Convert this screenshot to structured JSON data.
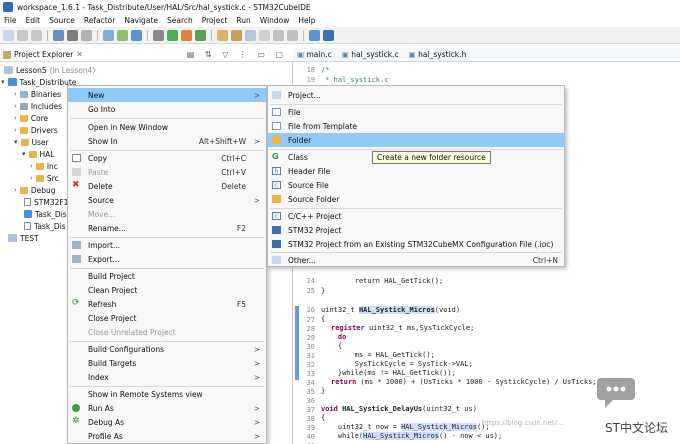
{
  "window": {
    "title": "workspace_1.6.1 - Task_Distribute/User/HAL/Src/hal_systick.c - STM32CubeIDE"
  },
  "menubar": [
    "File",
    "Edit",
    "Source",
    "Refactor",
    "Navigate",
    "Search",
    "Project",
    "Run",
    "Window",
    "Help"
  ],
  "explorer": {
    "title": "Project Explorer",
    "tree": [
      {
        "label": "Lesson5",
        "suffix": "(in Lesson4)"
      },
      {
        "label": "Task_Distribute"
      },
      {
        "label": "Binaries"
      },
      {
        "label": "Includes"
      },
      {
        "label": "Core"
      },
      {
        "label": "Drivers"
      },
      {
        "label": "User"
      },
      {
        "label": "HAL"
      },
      {
        "label": "Inc"
      },
      {
        "label": "Src"
      },
      {
        "label": "Debug"
      },
      {
        "label": "STM32F1"
      },
      {
        "label": "Task_Dis"
      },
      {
        "label": "Task_Dis"
      },
      {
        "label": "TEST"
      }
    ]
  },
  "editor": {
    "tabs": [
      "main.c",
      "hal_systick.c",
      "hal_systick.h"
    ],
    "line_numbers": [
      "18",
      "19",
      "20",
      "24",
      "25",
      "26",
      "27",
      "28",
      "29",
      "30",
      "31",
      "32",
      "33",
      "34",
      "35",
      "36",
      "37",
      "38",
      "39",
      "40",
      "41"
    ],
    "code": {
      "l18": "/*",
      "l19": " * hal_systick.c",
      "l20": " *",
      "l24": "    return HAL_GetTick();",
      "l25": "}",
      "l26_type": "uint32_t ",
      "l26_fn": "HAL_Systick_Micros",
      "l26_rest": "(void)",
      "l27": "{",
      "l28_kw": "register ",
      "l28_rest": "uint32_t ms,SysTickCycle;",
      "l29": "    do",
      "l30": "    {",
      "l31": "        ms = HAL_GetTick();",
      "l32": "        SysTickCycle = SysTick->VAL;",
      "l33": "    }while(ms != HAL_GetTick());",
      "l34_kw": "return ",
      "l34_rest": "(ms * 1000) + (UsTicks * 1000 - SystickCycle) / UsTicks;",
      "l35": "}",
      "l36": "",
      "l37_kw": "void ",
      "l37_fn": "HAL_Systick_DelayUs",
      "l37_rest": "(uint32_t us)",
      "l38": "{",
      "l39_a": "    uint32_t now = ",
      "l39_b": "HAL_Systick_Micros",
      "l39_c": "();",
      "l40_a": "    while(",
      "l40_b": "HAL_Systick_Micros",
      "l40_c": "() - now < us);",
      "l41": "}"
    }
  },
  "context_menu": {
    "items": [
      {
        "label": "New",
        "arrow": ">",
        "selected": true
      },
      {
        "label": "Go Into"
      },
      {
        "label": "Open in New Window"
      },
      {
        "label": "Show In",
        "key": "Alt+Shift+W",
        "arrow": ">"
      },
      {
        "label": "Copy",
        "key": "Ctrl+C"
      },
      {
        "label": "Paste",
        "key": "Ctrl+V",
        "disabled": true
      },
      {
        "label": "Delete",
        "key": "Delete"
      },
      {
        "label": "Source",
        "arrow": ">"
      },
      {
        "label": "Move...",
        "disabled": true
      },
      {
        "label": "Rename...",
        "key": "F2"
      },
      {
        "label": "Import..."
      },
      {
        "label": "Export..."
      },
      {
        "label": "Build Project"
      },
      {
        "label": "Clean Project"
      },
      {
        "label": "Refresh",
        "key": "F5"
      },
      {
        "label": "Close Project"
      },
      {
        "label": "Close Unrelated Project",
        "disabled": true
      },
      {
        "label": "Build Configurations",
        "arrow": ">"
      },
      {
        "label": "Build Targets",
        "arrow": ">"
      },
      {
        "label": "Index",
        "arrow": ">"
      },
      {
        "label": "Show in Remote Systems view"
      },
      {
        "label": "Run As",
        "arrow": ">"
      },
      {
        "label": "Debug As",
        "arrow": ">"
      },
      {
        "label": "Profile As",
        "arrow": ">"
      }
    ]
  },
  "submenu_new": {
    "items": [
      {
        "label": "Project..."
      },
      {
        "label": "File"
      },
      {
        "label": "File from Template"
      },
      {
        "label": "Folder",
        "selected": true
      },
      {
        "label": "Class"
      },
      {
        "label": "Header File"
      },
      {
        "label": "Source File"
      },
      {
        "label": "Source Folder"
      },
      {
        "label": "C/C++ Project"
      },
      {
        "label": "STM32 Project"
      },
      {
        "label": "STM32 Project from an Existing STM32CubeMX Configuration File (.ioc)"
      },
      {
        "label": "Other...",
        "key": "Ctrl+N"
      }
    ]
  },
  "tooltip": "Create a new folder resource",
  "watermark": {
    "text": "ST中文论坛",
    "url_fragment": "https://blog.csdn.net/..."
  },
  "colors": {
    "selection": "#91c9f7",
    "menu_bg": "#f7f7f7",
    "keyword": "#7f0055",
    "comment": "#3f7f5f"
  }
}
